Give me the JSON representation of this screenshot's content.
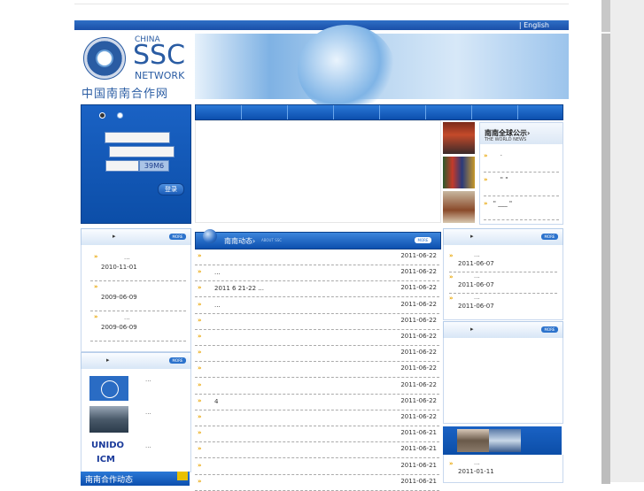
{
  "header": {
    "lang_label": "| English",
    "logo_china": "CHINA",
    "logo_ssc": "SSC",
    "logo_network": "NETWORK",
    "logo_cn_name": "中国南南合作网"
  },
  "login": {
    "captcha_code": "39M6",
    "submit_label": "登录"
  },
  "world_news": {
    "title": "南南全球公示›",
    "subtitle": "THE WORLD NEWS",
    "items": [
      "·",
      "\"  \"",
      "\"   ___   \""
    ]
  },
  "left_news": {
    "more": "MORE",
    "items": [
      {
        "dots": "...",
        "date": "2010-11-01"
      },
      {
        "dots": "",
        "date": "2009-06-09"
      },
      {
        "dots": "...",
        "date": "2009-06-09"
      }
    ]
  },
  "partners": {
    "more": "MORE",
    "items": [
      {
        "text": "..."
      },
      {
        "text": "..."
      },
      {
        "text": "..."
      }
    ],
    "unido_label": "UNIDO",
    "icm_label": "ICM"
  },
  "ssc_news_bar": {
    "label": "南南合作动态"
  },
  "center": {
    "head_title": "南南动态›",
    "head_subtitle": "ABOUT SSC",
    "more": "MORE",
    "rows": [
      {
        "text": "",
        "date": "2011-06-22"
      },
      {
        "text": "...",
        "date": "2011-06-22"
      },
      {
        "text": "2011 6 21-22          ...",
        "date": "2011-06-22"
      },
      {
        "text": "...",
        "date": "2011-06-22"
      },
      {
        "text": "",
        "date": "2011-06-22"
      },
      {
        "text": "",
        "date": "2011-06-22"
      },
      {
        "text": "",
        "date": "2011-06-22"
      },
      {
        "text": "",
        "date": "2011-06-22"
      },
      {
        "text": "",
        "date": "2011-06-22"
      },
      {
        "text": "4",
        "date": "2011-06-22"
      },
      {
        "text": "",
        "date": "2011-06-22"
      },
      {
        "text": "",
        "date": "2011-06-21"
      },
      {
        "text": "",
        "date": "2011-06-21"
      },
      {
        "text": "",
        "date": "2011-06-21"
      },
      {
        "text": "",
        "date": "2011-06-21"
      }
    ]
  },
  "right_news": {
    "more": "MORE",
    "items": [
      {
        "dots": "...",
        "date": "2011-06-07"
      },
      {
        "dots": "...",
        "date": "2011-06-07"
      },
      {
        "dots": "...",
        "date": "2011-06-07"
      }
    ]
  },
  "right_panel2": {
    "more": "MORE"
  },
  "right_bottom": {
    "items": [
      {
        "dots": "...",
        "date": "2011-01-11"
      }
    ]
  },
  "colors": {
    "brand_blue": "#0c4fae",
    "accent_arrow": "#e8a400"
  }
}
